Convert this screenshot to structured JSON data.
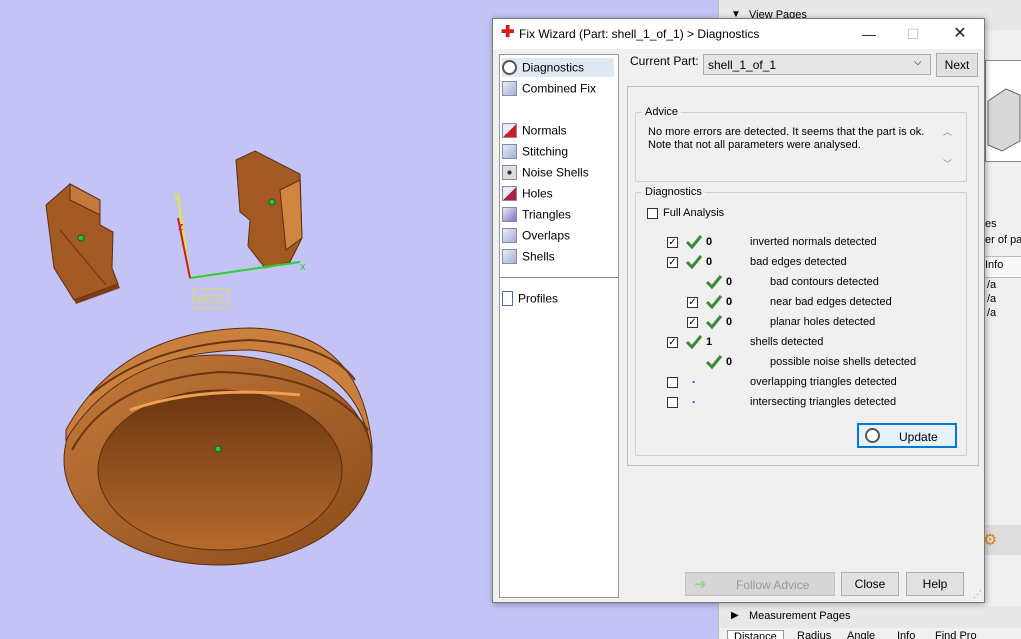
{
  "viewport": {
    "wcs_label": "WCS",
    "axis_x": "x",
    "axis_y": "y",
    "axis_z": "z"
  },
  "background_panel": {
    "view_pages": "View Pages",
    "es_text": "es",
    "er_text": "er of pa",
    "info_header": "Info",
    "na_values": [
      "/a",
      "/a",
      "/a"
    ],
    "measurement_pages": "Measurement Pages",
    "bottom_tabs": [
      "Distance",
      "Radius",
      "Angle",
      "Info",
      "Find Pro"
    ]
  },
  "dialog": {
    "title": "Fix Wizard (Part: shell_1_of_1) > Diagnostics",
    "nav_items": {
      "diagnostics": "Diagnostics",
      "combined_fix": "Combined Fix",
      "normals": "Normals",
      "stitching": "Stitching",
      "noise_shells": "Noise Shells",
      "holes": "Holes",
      "triangles": "Triangles",
      "overlaps": "Overlaps",
      "shells": "Shells",
      "profiles": "Profiles"
    },
    "current_part_label": "Current Part:",
    "current_part_value": "shell_1_of_1",
    "next_label": "Next",
    "advice_title": "Advice",
    "advice_text_1": "No more errors are detected. It seems that the part is ok.",
    "advice_text_2": "Note that not all parameters were analysed.",
    "diagnostics_title": "Diagnostics",
    "full_analysis_label": "Full Analysis",
    "rows": [
      {
        "checked": true,
        "count": "0",
        "label": "inverted normals detected"
      },
      {
        "checked": true,
        "count": "0",
        "label": "bad edges detected"
      },
      {
        "checked": null,
        "count": "0",
        "label": "bad contours detected"
      },
      {
        "checked": true,
        "count": "0",
        "label": "near bad edges detected"
      },
      {
        "checked": true,
        "count": "0",
        "label": "planar holes detected"
      },
      {
        "checked": true,
        "count": "1",
        "label": "shells detected"
      },
      {
        "checked": null,
        "count": "0",
        "label": "possible noise shells detected"
      },
      {
        "checked": false,
        "count": "",
        "label": "overlapping triangles detected"
      },
      {
        "checked": false,
        "count": "",
        "label": "intersecting triangles detected"
      }
    ],
    "update_label": "Update",
    "follow_advice_label": "Follow Advice",
    "close_label": "Close",
    "help_label": "Help"
  }
}
